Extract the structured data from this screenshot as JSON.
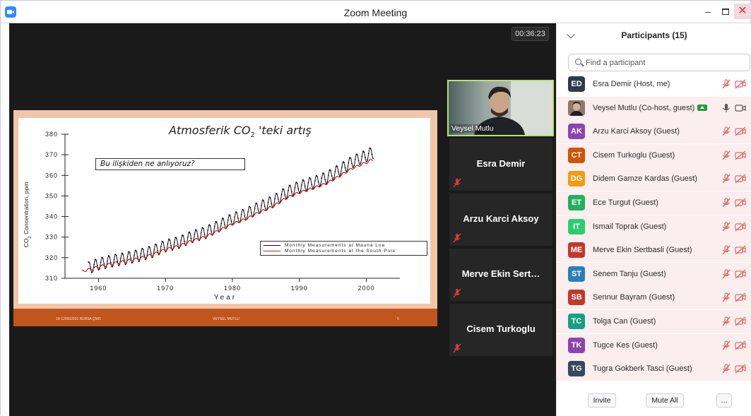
{
  "window": {
    "title": "Zoom Meeting",
    "minimize": "–",
    "close": "✕"
  },
  "meeting": {
    "timer": "00:36:23",
    "slide": {
      "title_main": "Atmosferik CO",
      "title_sub": "2",
      "title_rest": " 'teki artış",
      "question": "Bu ilişkiden ne anlıyoruz?",
      "ylabel_main": "CO",
      "ylabel_sub": "2",
      "ylabel_rest": " Concentration, ppm",
      "footer_left": "10-12/06/2021 BURSA ÇMO",
      "footer_center": "VEYSEL MUTLU",
      "footer_right": "5",
      "legend": [
        "Monthly Measurements at Mauna Loa",
        "Monthly Measurements at the South Pole"
      ]
    },
    "tiles": [
      {
        "name": "Veysel Mutlu",
        "video": true
      },
      {
        "name": "Esra Demir"
      },
      {
        "name": "Arzu Karci Aksoy"
      },
      {
        "name": "Merve  Ekin  Sert…"
      },
      {
        "name": "Cisem Turkoglu"
      }
    ]
  },
  "chart_data": {
    "type": "line",
    "title": "Atmosferik CO2 'teki artış",
    "xlabel": "Year",
    "ylabel": "CO2 Concentration, ppm",
    "xlim": [
      1955,
      2005
    ],
    "ylim": [
      310,
      380
    ],
    "xticks": [
      1960,
      1970,
      1980,
      1990,
      2000
    ],
    "yticks": [
      310,
      320,
      330,
      340,
      350,
      360,
      370,
      380
    ],
    "series": [
      {
        "name": "Monthly Measurements at Mauna Loa",
        "color": "#111111",
        "x": [
          1958.5,
          1960,
          1962,
          1964,
          1966,
          1968,
          1970,
          1972,
          1974,
          1976,
          1978,
          1980,
          1982,
          1984,
          1986,
          1988,
          1990,
          1992,
          1994,
          1996,
          1998,
          2000,
          2001
        ],
        "y": [
          315,
          316.9,
          318.4,
          319.6,
          321.1,
          322.9,
          325.7,
          327.4,
          330.2,
          332.2,
          335.4,
          338.7,
          341.1,
          344.4,
          347.2,
          351.5,
          354.4,
          356.4,
          358.8,
          362.6,
          366.7,
          369.5,
          371.1
        ],
        "seasonal_amplitude_ppm": 3
      },
      {
        "name": "Monthly Measurements at the South Pole",
        "color": "#cc1f1f",
        "x": [
          1957.5,
          1960,
          1962,
          1964,
          1966,
          1968,
          1970,
          1972,
          1974,
          1976,
          1978,
          1980,
          1982,
          1984,
          1986,
          1988,
          1990,
          1992,
          1994,
          1996,
          1998,
          2000,
          2001
        ],
        "y": [
          313.4,
          315.5,
          317.1,
          318.3,
          319.6,
          321.4,
          324,
          325.6,
          328.3,
          330.2,
          333.2,
          336.4,
          338.8,
          342,
          344.8,
          348.9,
          351.7,
          353.7,
          356,
          359.7,
          363.6,
          366.3,
          367.8
        ],
        "seasonal_amplitude_ppm": 0.6
      }
    ],
    "legend_position": "lower-right"
  },
  "participants": {
    "title": "Participants (15)",
    "search_placeholder": "Find a participant",
    "items": [
      {
        "initials": "ED",
        "color": "#2f3a4a",
        "name": "Esra Demir (Host, me)",
        "mic": "muted",
        "cam": "off"
      },
      {
        "initials": "",
        "color": "#6b5a4e",
        "name": "Veysel Mutlu (Co-host, guest)",
        "mic": "on",
        "cam": "on",
        "sharing": true,
        "photo": true
      },
      {
        "initials": "AK",
        "color": "#8e44ad",
        "name": "Arzu Karci Aksoy (Guest)",
        "mic": "muted",
        "cam": "off"
      },
      {
        "initials": "CT",
        "color": "#d35400",
        "name": "Cisem Turkoglu (Guest)",
        "mic": "muted",
        "cam": "off"
      },
      {
        "initials": "DG",
        "color": "#f39c12",
        "name": "Didem Gamze Kardas (Guest)",
        "mic": "muted",
        "cam": "off"
      },
      {
        "initials": "ET",
        "color": "#27ae60",
        "name": "Ece Turgut (Guest)",
        "mic": "muted",
        "cam": "off"
      },
      {
        "initials": "IT",
        "color": "#2ecc71",
        "name": "Ismail Toprak (Guest)",
        "mic": "muted",
        "cam": "off"
      },
      {
        "initials": "ME",
        "color": "#c0392b",
        "name": "Merve Ekin Sertbasli (Guest)",
        "mic": "muted",
        "cam": "off"
      },
      {
        "initials": "ST",
        "color": "#2980b9",
        "name": "Senem Tanju (Guest)",
        "mic": "muted",
        "cam": "off"
      },
      {
        "initials": "SB",
        "color": "#c0392b",
        "name": "Sennur Bayram (Guest)",
        "mic": "muted",
        "cam": "off"
      },
      {
        "initials": "TC",
        "color": "#16a085",
        "name": "Tolga Can (Guest)",
        "mic": "muted",
        "cam": "off"
      },
      {
        "initials": "TK",
        "color": "#8e44ad",
        "name": "Tugce Kes (Guest)",
        "mic": "muted",
        "cam": "off"
      },
      {
        "initials": "TG",
        "color": "#34495e",
        "name": "Tugra Gokberk Tasci (Guest)",
        "mic": "muted",
        "cam": "off"
      }
    ],
    "buttons": {
      "invite": "Invite",
      "mute_all": "Mute All",
      "more": "..."
    }
  }
}
